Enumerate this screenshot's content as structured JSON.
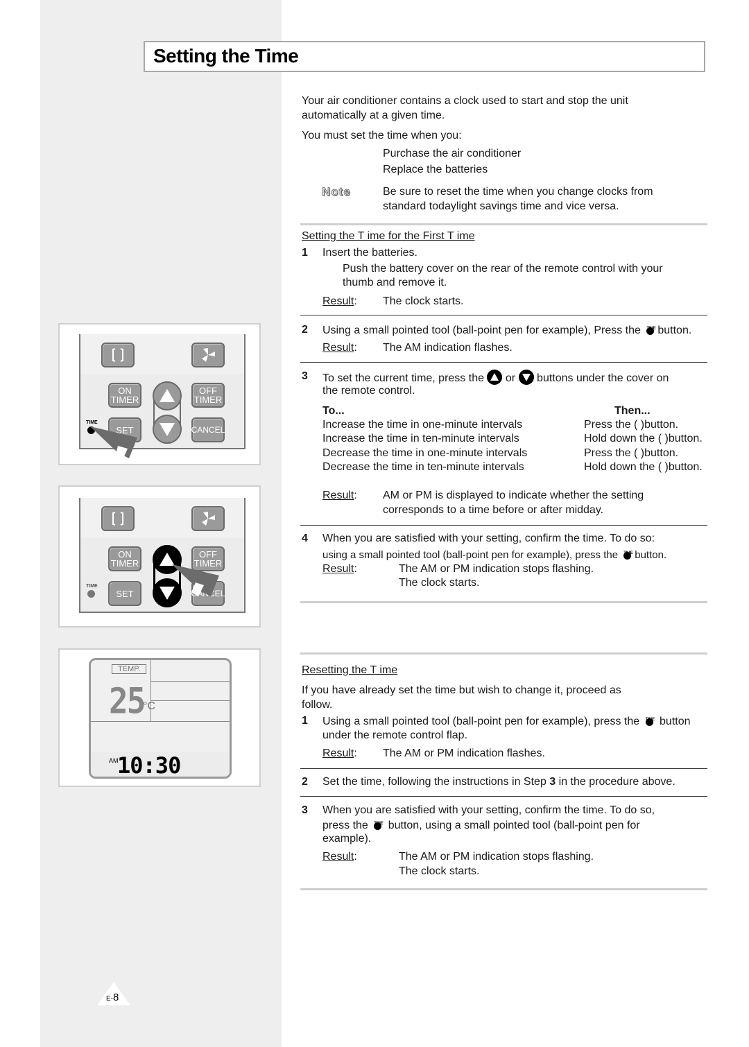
{
  "page": {
    "title": "Setting the Time",
    "page_number_prefix": "E-",
    "page_number": "8"
  },
  "intro": {
    "paragraph1_line1": "Your air conditioner contains a clock used to start and stop the unit",
    "paragraph1_line2": "automatically at a given time.",
    "paragraph2": "You must set the time when you:",
    "bullets": [
      "Purchase the air conditioner",
      "Replace the batteries"
    ],
    "note_label": "Note",
    "note_line1": "Be sure to reset the time when you change clocks from",
    "note_line2": "standard todaylight savings time and vice versa."
  },
  "first_time": {
    "heading": "Setting the T  ime for the First T  ime",
    "result_label": "Result",
    "step1": {
      "num": "1",
      "text": "Insert the batteries.",
      "detail_line1": "Push the battery cover on the rear of the remote control with your",
      "detail_line2": "thumb and remove it.",
      "result": "The clock starts."
    },
    "step2": {
      "num": "2",
      "text_before": "Using a small pointed tool (ball-point pen for example), Press the",
      "text_after": "button.",
      "result": "The AM indication flashes."
    },
    "step3": {
      "num": "3",
      "text_before": "To set the current time, press the",
      "text_or": "or",
      "text_after": "buttons under the cover on",
      "text_line2": "the remote control.",
      "table_header_to": "To...",
      "table_header_then": "Then...",
      "rows": [
        {
          "to": "Increase the time in one-minute intervals",
          "then": "Press the (    )button."
        },
        {
          "to": "Increase the time in ten-minute intervals",
          "then": "Hold down the (    )button."
        },
        {
          "to": "Decrease the time in one-minute intervals",
          "then": "Press the (    )button."
        },
        {
          "to": "Decrease the time in ten-minute intervals",
          "then": "Hold down the (    )button."
        }
      ],
      "result_line1": "AM or PM is displayed to indicate whether the setting",
      "result_line2": "corresponds to a time before or after midday."
    },
    "step4": {
      "num": "4",
      "text": "When you are satisfied with your setting, confirm the time. To do so:",
      "text2_before": "using a small pointed tool (ball-point pen for example), press the",
      "text2_after": "button.",
      "result_line1": "The AM or PM indication stops flashing.",
      "result_line2": "The clock starts."
    }
  },
  "resetting": {
    "heading": "Resetting the T  ime",
    "intro_line1": "If you have already set the time but wish to change it, proceed as",
    "intro_line2": "follow.",
    "result_label": "Result",
    "step1": {
      "num": "1",
      "text_before": "Using a small pointed tool (ball-point pen for example), press the",
      "text_after": "button",
      "text_line2": "under the remote control flap.",
      "result": "The AM or PM indication flashes."
    },
    "step2": {
      "num": "2",
      "text_before": "Set the time, following the instructions in Step",
      "step_ref": "3",
      "text_after": "in the procedure above."
    },
    "step3": {
      "num": "3",
      "text_line1": "When you are satisfied with your setting, confirm the time. To do so,",
      "text_before": "press the",
      "text_after": "button, using a small pointed tool (ball-point pen for",
      "text_line3": "example).",
      "result_line1": "The AM or PM indication stops flashing.",
      "result_line2": "The clock starts."
    }
  },
  "illustrations": {
    "remote_buttons": {
      "on_timer_1": "ON",
      "on_timer_2": "TIMER",
      "off_timer_1": "OFF",
      "off_timer_2": "TIMER",
      "set": "SET",
      "cancel": "CANCEL",
      "time_label": "TIME"
    },
    "lcd": {
      "temp_label": "TEMP.",
      "temperature": "25",
      "unit": "°C",
      "meridiem": "AM",
      "clock": "10:30"
    }
  },
  "icons": {
    "time_button_label": "TIME"
  }
}
